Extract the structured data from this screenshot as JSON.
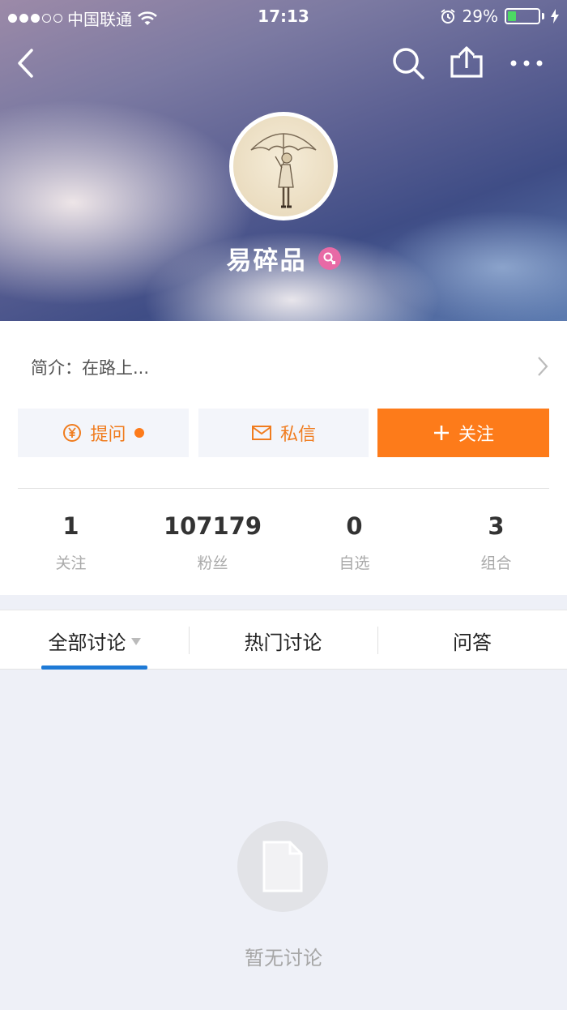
{
  "status_bar": {
    "carrier": "中国联通",
    "time": "17:13",
    "battery_percent": "29%",
    "battery_level": 0.29
  },
  "profile": {
    "username": "易碎品",
    "gender_badge": "female-icon",
    "intro": "简介：在路上..."
  },
  "actions": {
    "ask_label": "提问",
    "message_label": "私信",
    "follow_label": "关注"
  },
  "stats": [
    {
      "value": "1",
      "label": "关注"
    },
    {
      "value": "107179",
      "label": "粉丝"
    },
    {
      "value": "0",
      "label": "自选"
    },
    {
      "value": "3",
      "label": "组合"
    }
  ],
  "tabs": [
    {
      "label": "全部讨论"
    },
    {
      "label": "热门讨论"
    },
    {
      "label": "问答"
    }
  ],
  "empty_state": {
    "text": "暂无讨论"
  },
  "colors": {
    "accent_orange": "#fd7b1a",
    "tab_underline": "#1e7ad6",
    "gender_pink": "#e86aa6"
  }
}
